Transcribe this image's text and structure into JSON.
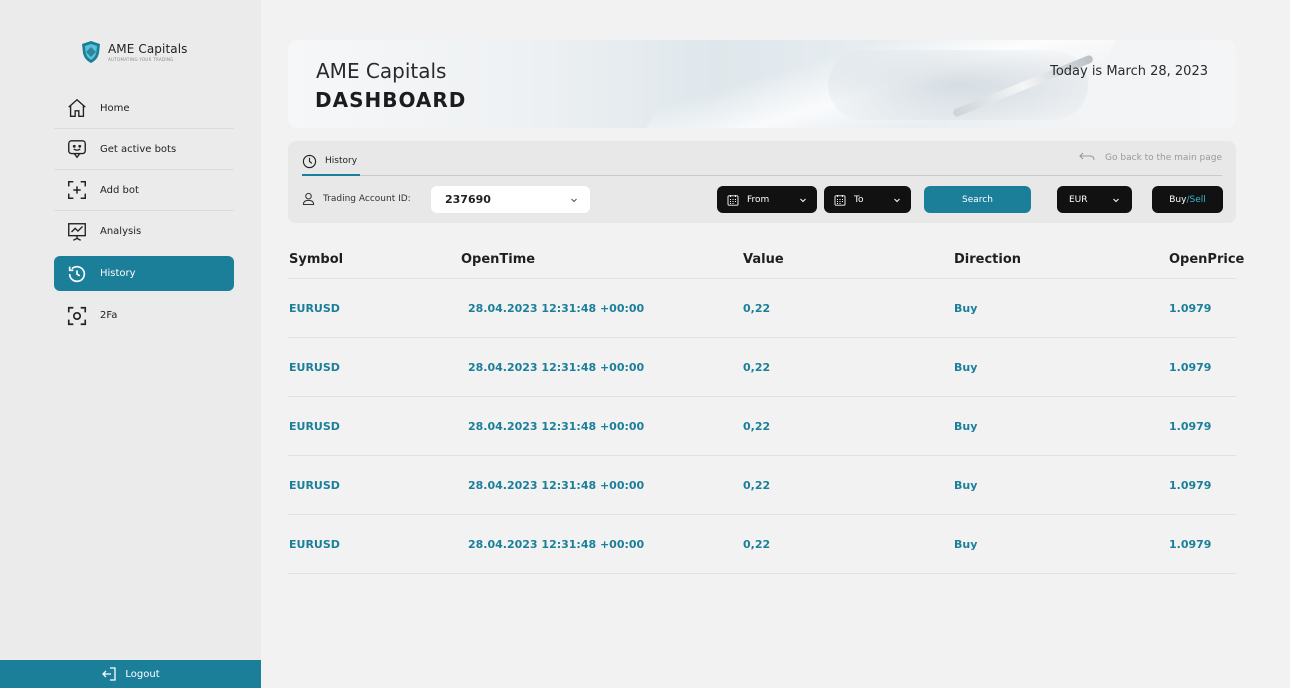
{
  "brand": {
    "name": "AME Capitals",
    "tagline": "AUTOMATING YOUR TRADING"
  },
  "sidebar": {
    "items": [
      {
        "label": "Home",
        "icon": "home-icon"
      },
      {
        "label": "Get active bots",
        "icon": "bot-chat-icon"
      },
      {
        "label": "Add bot",
        "icon": "add-frame-icon"
      },
      {
        "label": "Analysis",
        "icon": "analysis-board-icon"
      },
      {
        "label": "History",
        "icon": "history-icon",
        "active": true
      },
      {
        "label": "2Fa",
        "icon": "scan-icon"
      }
    ],
    "logout_label": "Logout"
  },
  "banner": {
    "subtitle": "AME Capitals",
    "title": "DASHBOARD",
    "date_text": "Today is March 28, 2023"
  },
  "filters": {
    "tab_label": "History",
    "back_label": "Go back to the main page",
    "account_label": "Trading Account ID:",
    "account_value": "237690",
    "from_label": "From",
    "to_label": "To",
    "search_label": "Search",
    "currency_value": "EUR",
    "buy_label": "Buy",
    "separator": " / ",
    "sell_label": "Sell"
  },
  "table": {
    "columns": [
      "Symbol",
      "OpenTime",
      "Value",
      "Direction",
      "OpenPrice"
    ],
    "rows": [
      [
        "EURUSD",
        "28.04.2023 12:31:48 +00:00",
        "0,22",
        "Buy",
        "1.0979"
      ],
      [
        "EURUSD",
        "28.04.2023 12:31:48 +00:00",
        "0,22",
        "Buy",
        "1.0979"
      ],
      [
        "EURUSD",
        "28.04.2023 12:31:48 +00:00",
        "0,22",
        "Buy",
        "1.0979"
      ],
      [
        "EURUSD",
        "28.04.2023 12:31:48 +00:00",
        "0,22",
        "Buy",
        "1.0979"
      ],
      [
        "EURUSD",
        "28.04.2023 12:31:48 +00:00",
        "0,22",
        "Buy",
        "1.0979"
      ]
    ]
  },
  "colors": {
    "accent": "#1b7f9a",
    "sell_accent": "#3fb4cf",
    "dark_button": "#111111"
  }
}
